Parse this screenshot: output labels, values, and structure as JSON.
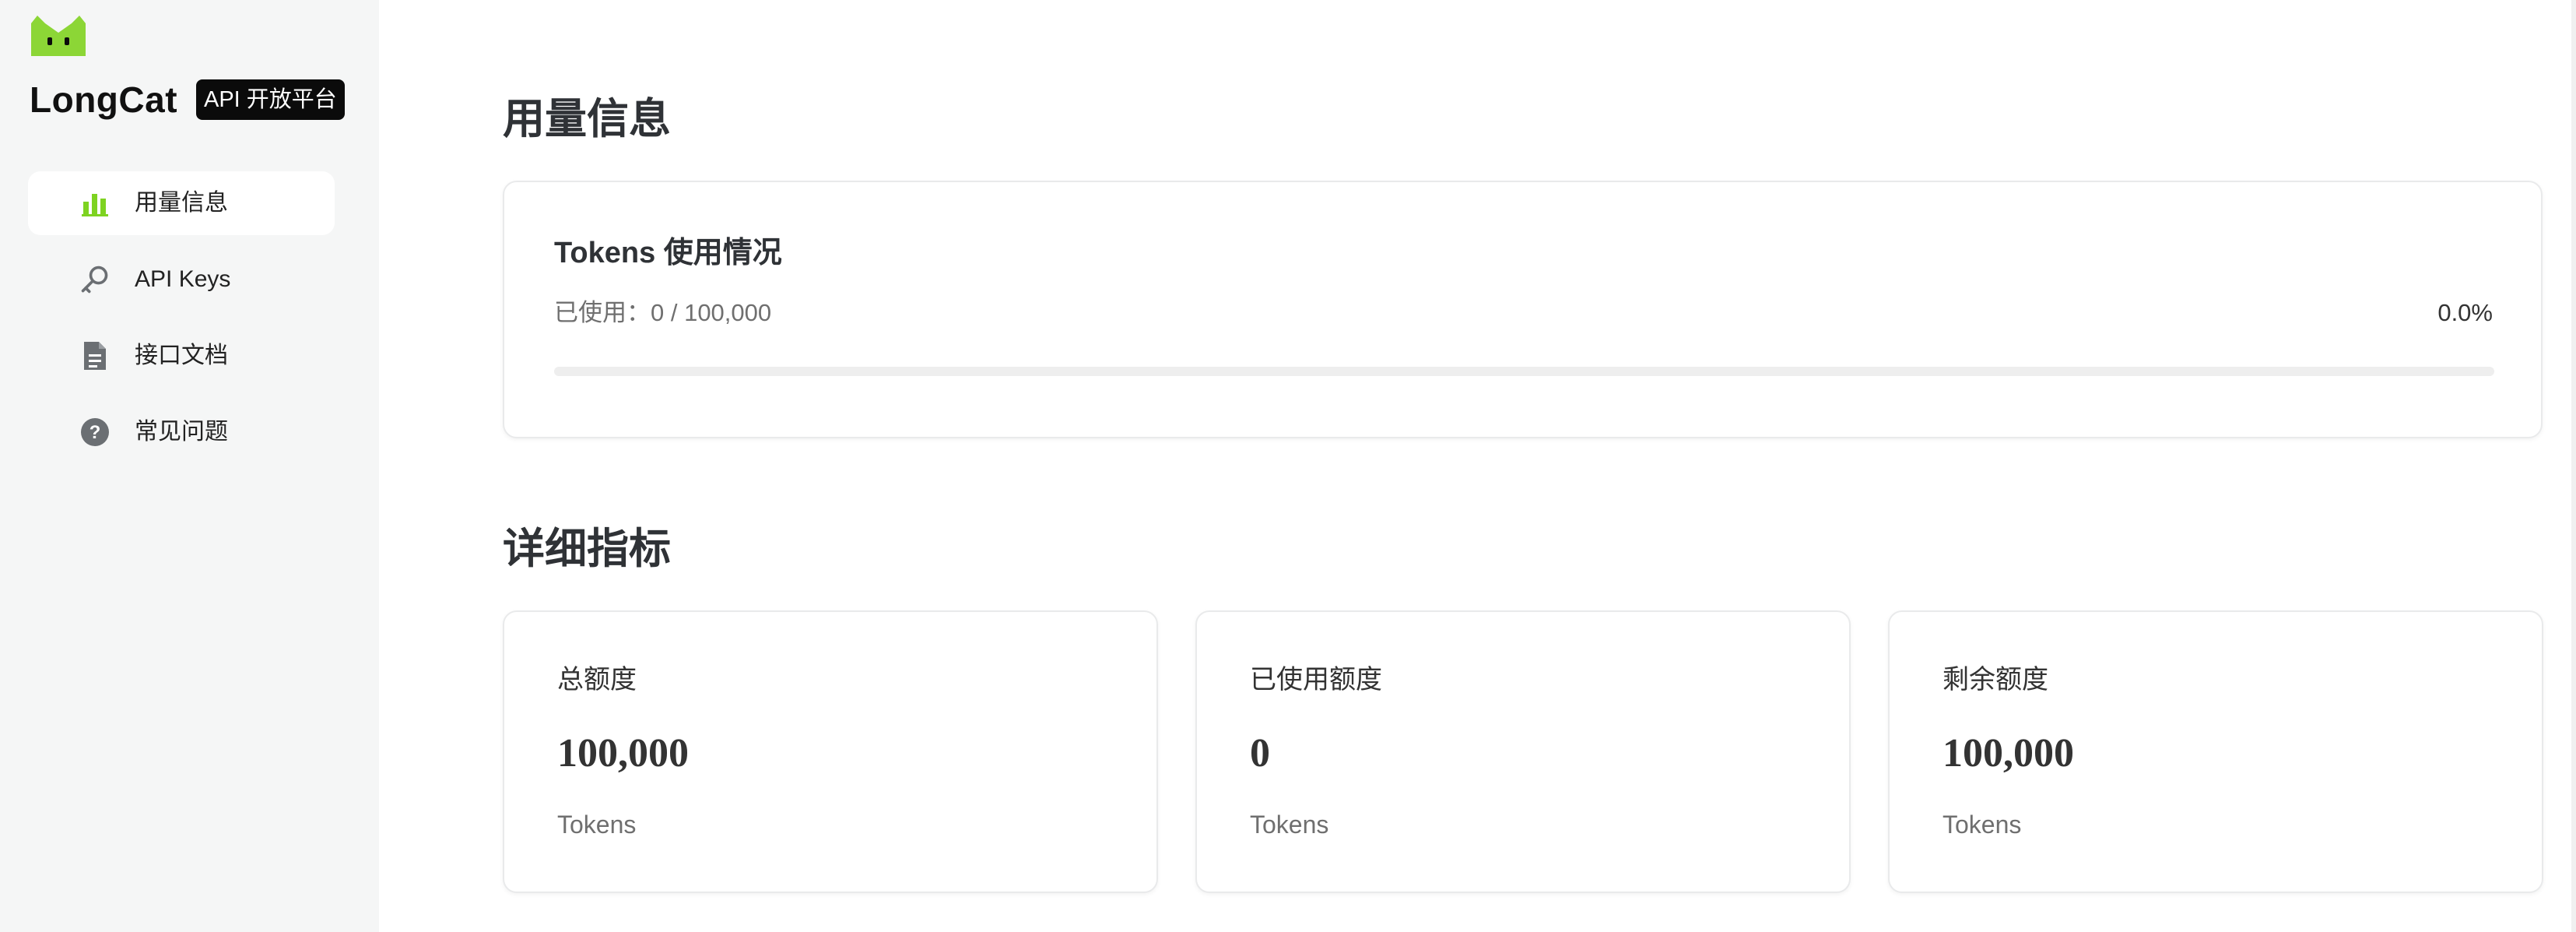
{
  "brand": {
    "name": "LongCat",
    "badge": "API 开放平台",
    "accent": "#7ed321"
  },
  "sidebar": {
    "items": [
      {
        "label": "用量信息",
        "icon": "bar-chart-icon",
        "active": true
      },
      {
        "label": "API Keys",
        "icon": "key-icon",
        "active": false
      },
      {
        "label": "接口文档",
        "icon": "document-icon",
        "active": false
      },
      {
        "label": "常见问题",
        "icon": "question-circle-icon",
        "active": false
      }
    ]
  },
  "main": {
    "usage_section_title": "用量信息",
    "usage_card": {
      "title": "Tokens 使用情况",
      "used_text": "已使用：0 / 100,000",
      "percent_text": "0.0%",
      "progress_fraction": 0.0
    },
    "details_section_title": "详细指标",
    "metrics": [
      {
        "label": "总额度",
        "value": "100,000",
        "unit": "Tokens"
      },
      {
        "label": "已使用额度",
        "value": "0",
        "unit": "Tokens"
      },
      {
        "label": "剩余额度",
        "value": "100,000",
        "unit": "Tokens"
      }
    ]
  }
}
